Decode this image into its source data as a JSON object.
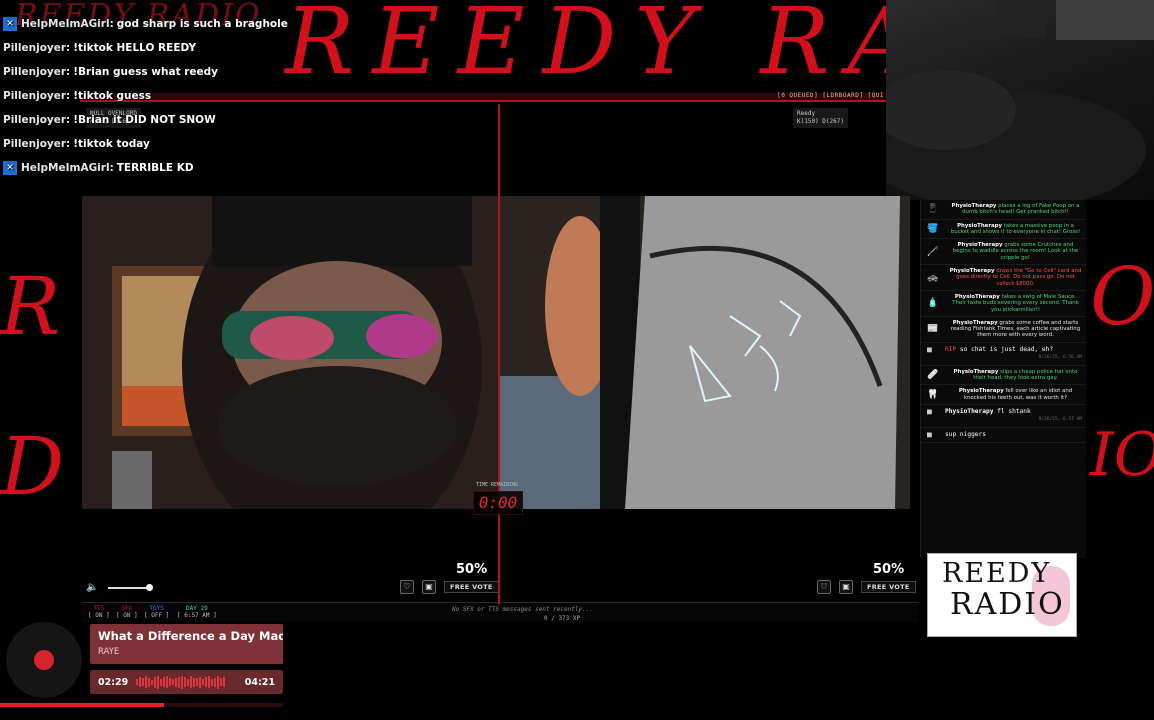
{
  "background": {
    "scrawl_title": "REEDY RADIO",
    "scrawl_sub": "REEDY RADIO",
    "scrawl_color": "#d0101a"
  },
  "chat": [
    {
      "badge": true,
      "nick": "HelpMeImAGirl:",
      "text": "god sharp is such a braghole"
    },
    {
      "badge": false,
      "nick": "Pillenjoyer:",
      "text": "!tiktok HELLO REEDY"
    },
    {
      "badge": false,
      "nick": "Pillenjoyer:",
      "text": "!Brian guess what reedy"
    },
    {
      "badge": false,
      "nick": "Pillenjoyer:",
      "text": "!tiktok guess"
    },
    {
      "badge": false,
      "nick": "Pillenjoyer:",
      "text": "!Brian it DID NOT SNOW"
    },
    {
      "badge": false,
      "nick": "Pillenjoyer:",
      "text": "!tiktok today"
    },
    {
      "badge": true,
      "nick": "HelpMeImAGirl:",
      "text": "TERRIBLE KD"
    }
  ],
  "topbar": {
    "items": "[0 QUEUED] [LDRBOARD] [QUI",
    "accent": "#b4121a"
  },
  "players": {
    "left_tag": "NULL OVENLORD\nK(43) D(169)",
    "right_tag": "Reedy\nK(150) D(267)"
  },
  "timer": {
    "label": "TIME REMAINING",
    "value": "0:00"
  },
  "votes": {
    "left_pct": "50%",
    "right_pct": "50%",
    "free_vote_label": "FREE VOTE"
  },
  "status": {
    "cells": [
      {
        "name": "TTS",
        "state": "[ ON ]",
        "color": "#d0101a"
      },
      {
        "name": "SFX",
        "state": "[ ON ]",
        "color": "#d0101a"
      },
      {
        "name": "TOYS",
        "state": "[ OFF ]",
        "color": "#3a7bd5"
      },
      {
        "name": "DAY 29",
        "state": "[ 6:57 AM ]",
        "color": "#4fd27a"
      }
    ],
    "message": "No SFX or TTS messages sent recently...",
    "xp": "0 / 373 XP"
  },
  "feed": [
    {
      "type": "action",
      "color": "green",
      "icon": "📱",
      "who": "PhysioTherapy",
      "text": "places a log of Fake Poop on a dumb bitch's head! Get pranked bitch!!"
    },
    {
      "type": "action",
      "color": "green",
      "icon": "🪣",
      "who": "PhysioTherapy",
      "text": "takes a massive poop in a bucket and shows it to everyone in chat! Gross!"
    },
    {
      "type": "action",
      "color": "green",
      "icon": "🦯",
      "who": "PhysioTherapy",
      "text": "grabs some Crutches and begins to waddle across the room! Look at the cripple go!"
    },
    {
      "type": "action",
      "color": "red",
      "icon": "🚓",
      "who": "PhysioTherapy",
      "text": "draws the \"Go to Cell\" card and goes directly to Cell. Do not pass go. Do not collect $8000."
    },
    {
      "type": "action",
      "color": "green",
      "icon": "🧴",
      "who": "PhysioTherapy",
      "text": "takes a swig of Male Sauce. Their taste buds severing every second. Thank you stickarmiller!!"
    },
    {
      "type": "action",
      "color": "white",
      "icon": "📰",
      "who": "PhysioTherapy",
      "text": "grabs some coffee and starts reading Fishtank Times, each article captivating them more with every word."
    },
    {
      "type": "chat",
      "nick": "RIP",
      "text": "so chat is just dead, eh?",
      "time": "9/26/25, 6:56 AM"
    },
    {
      "type": "action",
      "color": "green",
      "icon": "🩹",
      "who": "PhysioTherapy",
      "text": "slips a cheap police hat onto their head. they look extra gay."
    },
    {
      "type": "action",
      "color": "white",
      "icon": "🦷",
      "who": "PhysioTherapy",
      "text": "fell over like an idiot and knocked his teeth out, was it worth it?"
    },
    {
      "type": "chat",
      "nick": "PhysioTherapy",
      "white": true,
      "text": "fl shtank",
      "time": "9/26/25, 6:57 AM"
    },
    {
      "type": "chat",
      "nick": "",
      "text": "sup niggers",
      "time": ""
    }
  ],
  "logo": {
    "line1": "REEDY",
    "line2": "RADIO"
  },
  "music": {
    "title": "What a Difference a Day Made",
    "artist": "RAYE",
    "elapsed": "02:29",
    "duration": "04:21",
    "progress": 0.58,
    "accent": "#d8242c"
  }
}
